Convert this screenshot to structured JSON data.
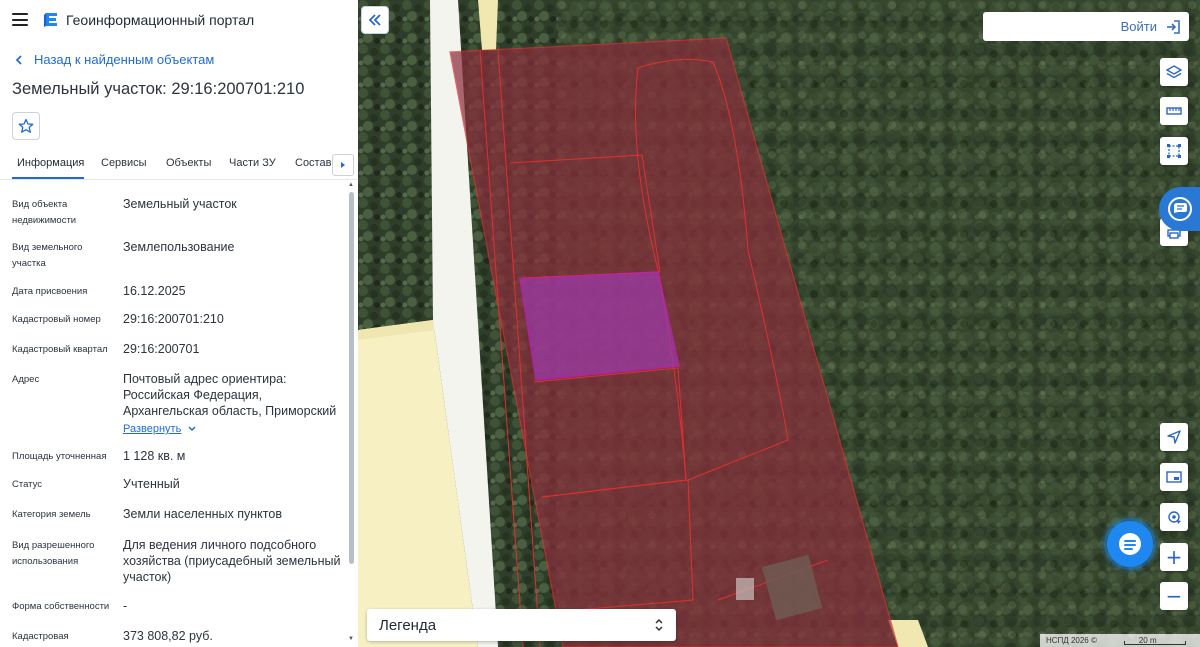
{
  "header": {
    "app_title": "Геоинформационный портал",
    "menu_icon": "hamburger-menu-icon",
    "logo_icon": "portal-logo-icon"
  },
  "panel": {
    "back_link": "Назад к найденным объектам",
    "object_title": "Земельный участок: 29:16:200701:210",
    "tabs": [
      "Информация",
      "Сервисы",
      "Объекты",
      "Части ЗУ",
      "Состав"
    ],
    "active_tab": "Информация",
    "expand_label": "Развернуть",
    "rows": [
      {
        "label": "Вид объекта недвижимости",
        "value": "Земельный участок"
      },
      {
        "label": "Вид земельного участка",
        "value": "Землепользование"
      },
      {
        "label": "Дата присвоения",
        "value": "16.12.2025"
      },
      {
        "label": "Кадастровый номер",
        "value": "29:16:200701:210"
      },
      {
        "label": "Кадастровый квартал",
        "value": "29:16:200701"
      },
      {
        "label": "Адрес",
        "value": "Почтовый адрес ориентира: Российская Федерация, Архангельская область, Приморский"
      },
      {
        "label": "Площадь уточненная",
        "value": "1 128 кв. м"
      },
      {
        "label": "Статус",
        "value": "Учтенный"
      },
      {
        "label": "Категория земель",
        "value": "Земли населенных пунктов"
      },
      {
        "label": "Вид разрешенного использования",
        "value": "Для ведения личного подсобного хозяйства (приусадебный земельный участок)"
      },
      {
        "label": "Форма собственности",
        "value": "-"
      },
      {
        "label": "Кадастровая",
        "value": "373 808,82 руб."
      }
    ]
  },
  "map": {
    "login_label": "Войти",
    "legend_label": "Легенда",
    "attribution": "НСПД 2026 ©",
    "scale_label": "20 m",
    "colors": {
      "parcel_fill": "#8a2f3c",
      "parcel_border": "#e0302e",
      "selected_fill": "#9c3aa6",
      "selected_border": "#c020c0",
      "forest": "#2c3b28",
      "road": "#f5efbe",
      "accent": "#2a66c6"
    },
    "tools": [
      "layers-icon",
      "ruler-icon",
      "select-area-icon",
      "feedback-icon",
      "print-icon",
      "navigate-icon",
      "picture-in-picture-icon",
      "geolocation-icon",
      "zoom-in-icon",
      "zoom-out-icon"
    ]
  }
}
